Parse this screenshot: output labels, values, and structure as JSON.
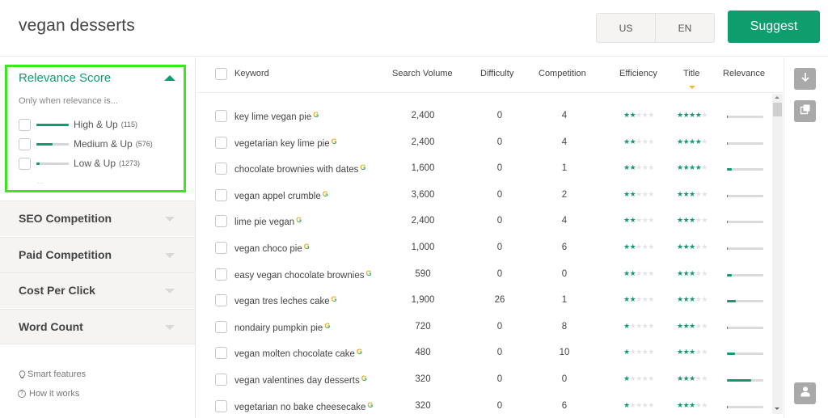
{
  "header": {
    "search_query": "vegan desserts",
    "country": "US",
    "language": "EN",
    "suggest_label": "Suggest"
  },
  "colors": {
    "brand": "#0e9d6d",
    "highlight_border": "#39e81d",
    "sort_indicator": "#f5b731"
  },
  "sidebar": {
    "relevance": {
      "title": "Relevance Score",
      "hint": "Only when relevance is...",
      "options": [
        {
          "label": "High & Up",
          "count": "(115)",
          "level": 1.0
        },
        {
          "label": "Medium & Up",
          "count": "(576)",
          "level": 0.5
        },
        {
          "label": "Low & Up",
          "count": "(1273)",
          "level": 0.1
        }
      ],
      "more": "..."
    },
    "sections": [
      {
        "label": "SEO Competition"
      },
      {
        "label": "Paid Competition"
      },
      {
        "label": "Cost Per Click"
      },
      {
        "label": "Word Count"
      }
    ],
    "links": [
      {
        "label": "Smart features",
        "icon": "lightbulb-icon"
      },
      {
        "label": "How it works",
        "icon": "help-circle-icon"
      }
    ]
  },
  "table": {
    "columns": {
      "keyword": "Keyword",
      "search_volume": "Search Volume",
      "difficulty": "Difficulty",
      "competition": "Competition",
      "efficiency": "Efficiency",
      "title": "Title",
      "relevance": "Relevance"
    },
    "sorted_by": "Title",
    "rows": [
      {
        "keyword": "key lime vegan pie",
        "volume": "2,400",
        "difficulty": "0",
        "competition": "4",
        "efficiency": 2,
        "title": 4,
        "relevance": 0.02
      },
      {
        "keyword": "vegetarian key lime pie",
        "volume": "2,400",
        "difficulty": "0",
        "competition": "4",
        "efficiency": 2,
        "title": 4,
        "relevance": 0.02
      },
      {
        "keyword": "chocolate brownies with dates",
        "volume": "1,600",
        "difficulty": "0",
        "competition": "1",
        "efficiency": 2,
        "title": 4,
        "relevance": 0.14
      },
      {
        "keyword": "vegan appel crumble",
        "volume": "3,600",
        "difficulty": "0",
        "competition": "2",
        "efficiency": 2,
        "title": 3,
        "relevance": 0.02
      },
      {
        "keyword": "lime pie vegan",
        "volume": "2,400",
        "difficulty": "0",
        "competition": "4",
        "efficiency": 2,
        "title": 3,
        "relevance": 0.02
      },
      {
        "keyword": "vegan choco pie",
        "volume": "1,000",
        "difficulty": "0",
        "competition": "6",
        "efficiency": 2,
        "title": 3,
        "relevance": 0.03
      },
      {
        "keyword": "easy vegan chocolate brownies",
        "volume": "590",
        "difficulty": "0",
        "competition": "0",
        "efficiency": 2,
        "title": 3,
        "relevance": 0.13
      },
      {
        "keyword": "vegan tres leches cake",
        "volume": "1,900",
        "difficulty": "26",
        "competition": "1",
        "efficiency": 2,
        "title": 3,
        "relevance": 0.25
      },
      {
        "keyword": "nondairy pumpkin pie",
        "volume": "720",
        "difficulty": "0",
        "competition": "8",
        "efficiency": 1,
        "title": 3,
        "relevance": 0.02
      },
      {
        "keyword": "vegan molten chocolate cake",
        "volume": "480",
        "difficulty": "0",
        "competition": "10",
        "efficiency": 1,
        "title": 3,
        "relevance": 0.23
      },
      {
        "keyword": "vegan valentines day desserts",
        "volume": "320",
        "difficulty": "0",
        "competition": "0",
        "efficiency": 1,
        "title": 3,
        "relevance": 0.67
      },
      {
        "keyword": "vegetarian no bake cheesecake",
        "volume": "320",
        "difficulty": "0",
        "competition": "6",
        "efficiency": 1,
        "title": 3,
        "relevance": 0.03
      }
    ]
  },
  "toolbar": {
    "buttons": [
      {
        "name": "download-button",
        "icon": "arrow-down-icon"
      },
      {
        "name": "copy-button",
        "icon": "copy-icon"
      },
      {
        "name": "account-button",
        "icon": "user-icon"
      }
    ]
  }
}
